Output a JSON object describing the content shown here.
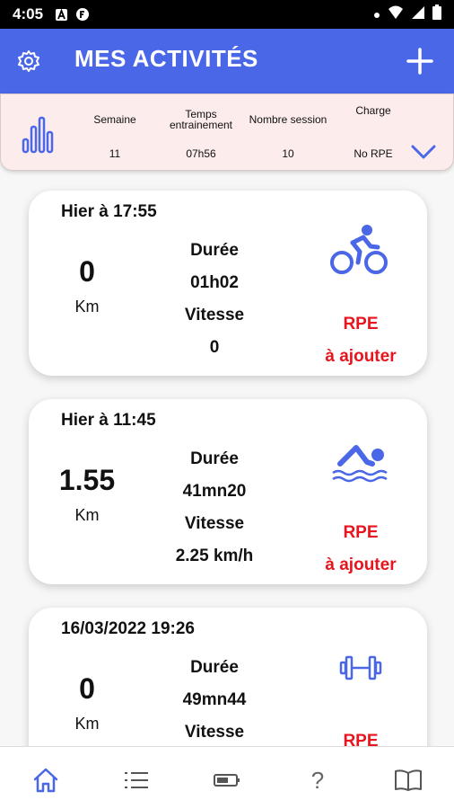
{
  "status_bar": {
    "time": "4:05"
  },
  "app_bar": {
    "title": "MES ACTIVITÉS"
  },
  "summary": {
    "columns": [
      {
        "label": "Semaine",
        "value": "11"
      },
      {
        "label": "Temps entrainement",
        "value": "07h56"
      },
      {
        "label": "Nombre session",
        "value": "10"
      },
      {
        "label": "Charge",
        "value": "No RPE"
      }
    ]
  },
  "activities": [
    {
      "date": "Hier à 17:55",
      "distance": "0",
      "unit": "Km",
      "duration_label": "Durée",
      "duration": "01h02",
      "speed_label": "Vitesse",
      "speed": "0",
      "rpe_label": "RPE",
      "rpe_action": "à ajouter",
      "sport_icon": "cycling-icon"
    },
    {
      "date": "Hier à 11:45",
      "distance": "1.55",
      "unit": "Km",
      "duration_label": "Durée",
      "duration": "41mn20",
      "speed_label": "Vitesse",
      "speed": "2.25 km/h",
      "rpe_label": "RPE",
      "rpe_action": "à ajouter",
      "sport_icon": "swimming-icon"
    },
    {
      "date": "16/03/2022 19:26",
      "distance": "0",
      "unit": "Km",
      "duration_label": "Durée",
      "duration": "49mn44",
      "speed_label": "Vitesse",
      "speed": "",
      "rpe_label": "RPE",
      "rpe_action": "",
      "sport_icon": "dumbbell-icon"
    }
  ],
  "bottom_nav": {
    "items": [
      "home-icon",
      "list-icon",
      "battery-icon",
      "help-icon",
      "book-icon"
    ],
    "help_glyph": "?"
  },
  "colors": {
    "primary": "#4a67e8",
    "rpe": "#e8141e",
    "summary_bg": "#fcecec"
  }
}
